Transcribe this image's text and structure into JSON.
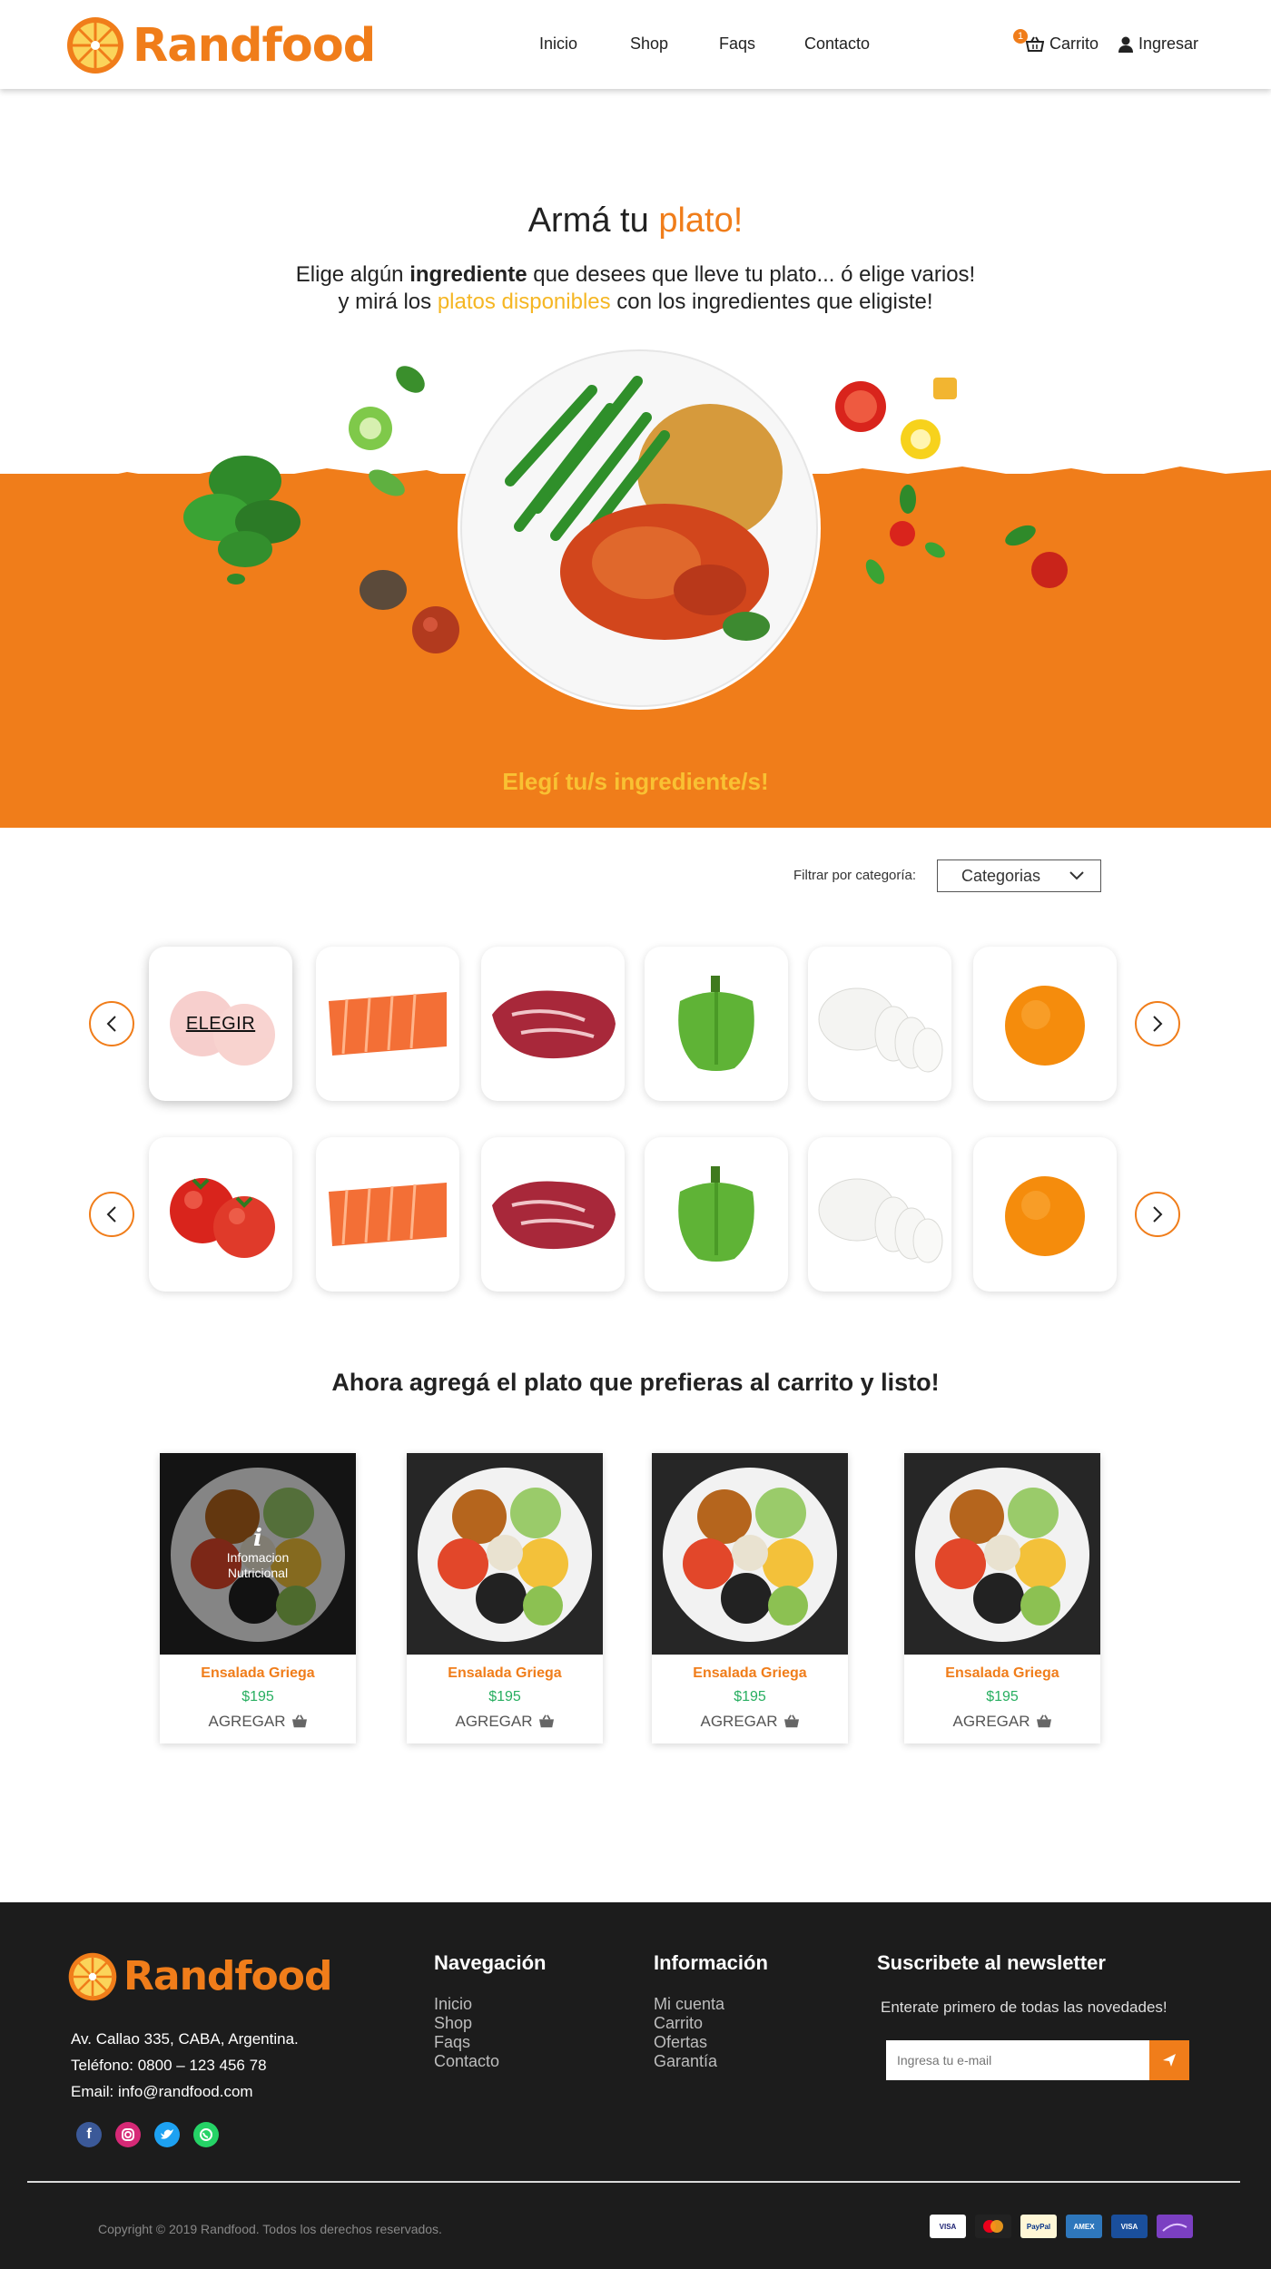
{
  "brand": {
    "name": "Randfood",
    "accent": "#f07d1a",
    "yellow": "#f5b623",
    "green": "#27ae60"
  },
  "header": {
    "nav": [
      "Inicio",
      "Shop",
      "Faqs",
      "Contacto"
    ],
    "cart_label": "Carrito",
    "cart_count": "1",
    "login_label": "Ingresar"
  },
  "hero": {
    "title_main": "Armá tu",
    "title_accent": "plato!",
    "sub_line1_a": "Elige algún",
    "sub_line1_bold": "ingrediente",
    "sub_line1_b": "que desees que lleve tu plato... ó elige varios!",
    "sub_line2_a": "y mirá los",
    "sub_line2_accent": "platos disponibles",
    "sub_line2_b": "con los ingredientes que eligiste!",
    "cta": "Elegí tu/s ingrediente/s!"
  },
  "filter": {
    "label": "Filtrar por categoría:",
    "selected": "Categorias"
  },
  "ingredients": {
    "choose_label": "ELEGIR",
    "row1": [
      "tomato",
      "salmon",
      "beef",
      "green-pepper",
      "mozzarella",
      "orange"
    ],
    "row2": [
      "tomato",
      "salmon",
      "beef",
      "green-pepper",
      "mozzarella",
      "orange"
    ]
  },
  "dishes": {
    "title": "Ahora agregá el plato que prefieras al carrito  y listo!",
    "info_line1": "Infomacion",
    "info_line2": "Nutricional",
    "items": [
      {
        "name": "Ensalada Griega",
        "price": "$195",
        "add": "AGREGAR"
      },
      {
        "name": "Ensalada Griega",
        "price": "$195",
        "add": "AGREGAR"
      },
      {
        "name": "Ensalada Griega",
        "price": "$195",
        "add": "AGREGAR"
      },
      {
        "name": "Ensalada Griega",
        "price": "$195",
        "add": "AGREGAR"
      }
    ]
  },
  "footer": {
    "address": "Av. Callao 335, CABA, Argentina.",
    "phone": "Teléfono: 0800 – 123 456 78",
    "email": "Email: info@randfood.com",
    "nav_title": "Navegación",
    "nav_links": [
      "Inicio",
      "Shop",
      "Faqs",
      "Contacto"
    ],
    "info_title": "Información",
    "info_links": [
      "Mi cuenta",
      "Carrito",
      "Ofertas",
      "Garantía"
    ],
    "newsletter_title": "Suscribete al newsletter",
    "newsletter_text": "Enterate primero de todas las novedades!",
    "newsletter_placeholder": "Ingresa tu e-mail",
    "copyright": "Copyright © 2019 Randfood. Todos los derechos reservados.",
    "social_icons": [
      "facebook-icon",
      "instagram-icon",
      "twitter-icon",
      "whatsapp-icon"
    ],
    "payment_icons": [
      "visa",
      "mastercard",
      "paypal",
      "american-express",
      "visa-electron",
      "lasen"
    ],
    "payment_labels": [
      "VISA",
      "",
      "PayPal",
      "AMEX",
      "VISA",
      ""
    ]
  }
}
